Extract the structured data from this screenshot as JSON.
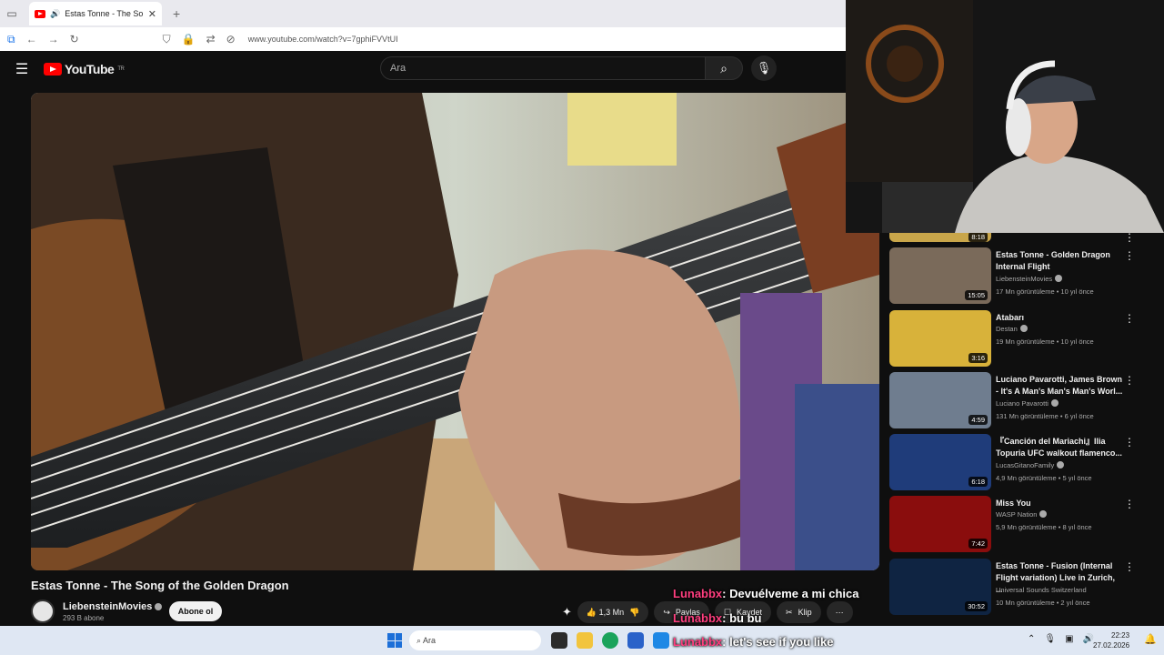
{
  "browser": {
    "tab_title": "Estas Tonne - The Song of t",
    "url": "www.youtube.com/watch?v=7gphiFVVtUI"
  },
  "youtube": {
    "region_badge": "TR",
    "logo_text": "YouTube",
    "search_placeholder": "Ara"
  },
  "video": {
    "title": "Estas Tonne - The Song of the Golden Dragon",
    "channel": "LiebensteinMovies",
    "subscribers": "293 B abone",
    "subscribe_label": "Abone ol",
    "likes": "1,3 Mn",
    "share_label": "Paylaş",
    "save_label": "Kaydet",
    "clip_label": "Klip"
  },
  "related": [
    {
      "duration": "8:18",
      "thumb_color": "#c9a64a"
    },
    {
      "title": "Estas Tonne - Golden Dragon Internal Flight",
      "channel": "LiebensteinMovies",
      "meta": "17 Mn görüntüleme • 10 yıl önce",
      "duration": "15:05",
      "thumb_color": "#7a6a5a"
    },
    {
      "title": "Atabarı",
      "channel": "Destan",
      "meta": "19 Mn görüntüleme • 10 yıl önce",
      "duration": "3:16",
      "thumb_color": "#d8b23a"
    },
    {
      "title": "Luciano Pavarotti, James Brown - It's A Man's Man's Man's Worl...",
      "channel": "Luciano Pavarotti",
      "meta": "131 Mn görüntüleme • 6 yıl önce",
      "duration": "4:59",
      "thumb_color": "#6f7d8f"
    },
    {
      "title": "『Canción del Mariachi』Ilia Topuria UFC walkout flamenco...",
      "channel": "LucasGitanoFamily",
      "meta": "4,9 Mn görüntüleme • 5 yıl önce",
      "duration": "6:18",
      "thumb_color": "#1f3c7a"
    },
    {
      "title": "Miss You",
      "channel": "WASP Nation",
      "meta": "5,9 Mn görüntüleme • 8 yıl önce",
      "duration": "7:42",
      "thumb_color": "#8a0d0d"
    },
    {
      "title": "Estas Tonne - Fusion (Internal Flight variation) Live in Zurich, ...",
      "channel": "Universal Sounds Switzerland",
      "meta": "10 Mn görüntüleme • 2 yıl önce",
      "duration": "30:52",
      "thumb_color": "#0f2442"
    }
  ],
  "chat": [
    {
      "user": "Lunabbx",
      "message": ": Devuélveme a mi chica"
    },
    {
      "user": "Lunabbx",
      "message": ": bu bu"
    },
    {
      "user": "Lunabbx",
      "message": ": let's see if you like"
    }
  ],
  "taskbar": {
    "search_placeholder": "Ara",
    "time": "22:23",
    "date": "27.02.2026"
  }
}
